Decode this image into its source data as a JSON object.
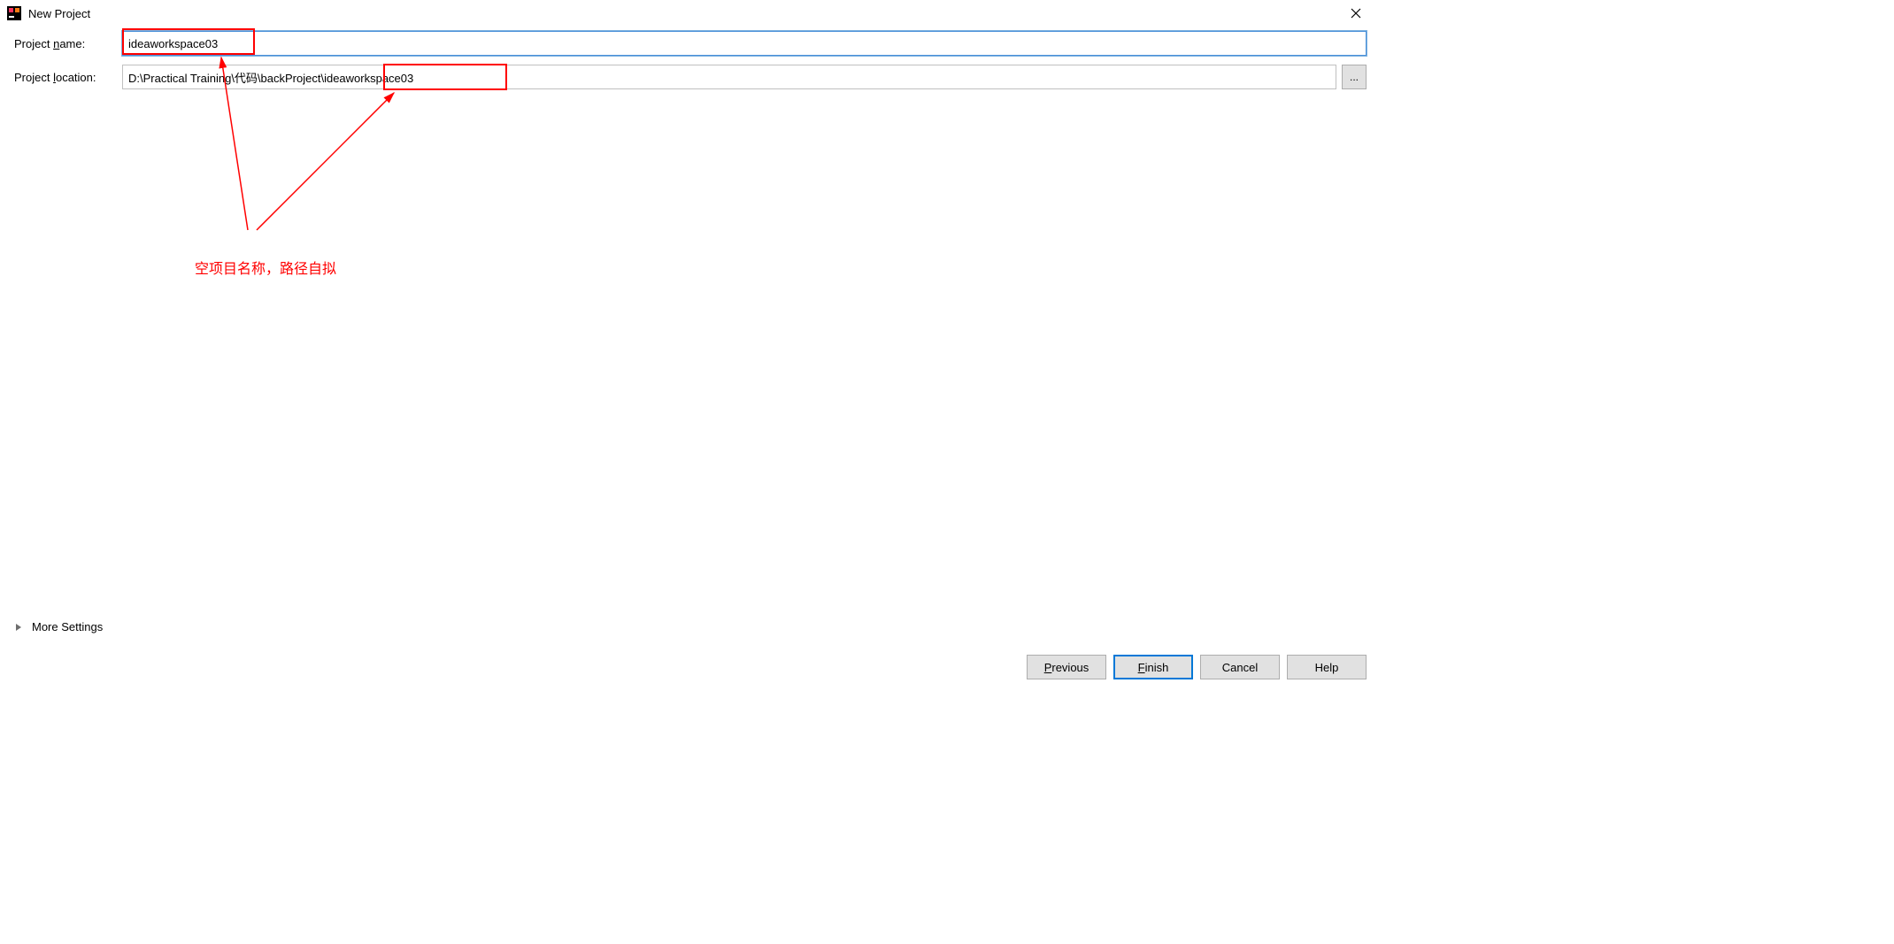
{
  "window": {
    "title": "New Project"
  },
  "form": {
    "project_name_label": "Project name:",
    "project_name_mnemonic": "n",
    "project_name_value": "ideaworkspace03",
    "project_location_label": "Project location:",
    "project_location_mnemonic": "l",
    "project_location_value": "D:\\Practical Training\\代码\\backProject\\ideaworkspace03",
    "browse_label": "..."
  },
  "annotation": {
    "text": "空项目名称，路径自拟"
  },
  "more_settings": {
    "label": "More Settings",
    "mnemonic": "e"
  },
  "buttons": {
    "previous": "Previous",
    "previous_mnemonic": "P",
    "finish": "Finish",
    "finish_mnemonic": "F",
    "cancel": "Cancel",
    "help": "Help"
  }
}
